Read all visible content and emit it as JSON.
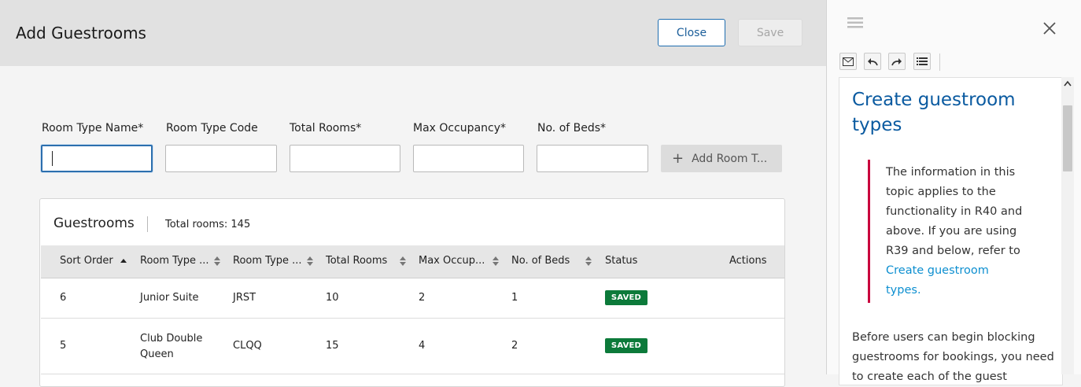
{
  "dialog": {
    "title": "Add Guestrooms",
    "close_label": "Close",
    "save_label": "Save"
  },
  "form": {
    "room_type_name_label": "Room Type Name*",
    "room_type_code_label": "Room Type Code",
    "total_rooms_label": "Total Rooms*",
    "max_occupancy_label": "Max Occupancy*",
    "no_of_beds_label": "No. of Beds*",
    "room_type_name_value": "",
    "room_type_code_value": "",
    "total_rooms_value": "",
    "max_occupancy_value": "",
    "no_of_beds_value": "",
    "add_button_label": "Add Room T..."
  },
  "grid": {
    "title": "Guestrooms",
    "total_rooms": "Total rooms: 145",
    "columns": [
      "Sort Order",
      "Room Type ...",
      "Room Type ...",
      "Total Rooms",
      "Max Occup...",
      "No. of Beds",
      "Status",
      "Actions"
    ],
    "rows": [
      {
        "sort_order": "6",
        "name": "Junior Suite",
        "code": "JRST",
        "total": "10",
        "occupancy": "2",
        "beds": "1",
        "status": "SAVED"
      },
      {
        "sort_order": "5",
        "name": "Club Double Queen",
        "code": "CLQQ",
        "total": "15",
        "occupancy": "4",
        "beds": "2",
        "status": "SAVED"
      }
    ]
  },
  "help_panel": {
    "title": "Create guestroom types",
    "note_text": "The information in this topic applies to the functionality in R40 and above. If you are using R39 and below, refer to ",
    "note_link": "Create guestroom types.",
    "body_text": "Before users can begin blocking guestrooms for bookings, you need to create each of the guest",
    "icons": [
      "menu-icon",
      "close-icon",
      "email-icon",
      "back-icon",
      "forward-icon",
      "toc-icon"
    ]
  },
  "colors": {
    "accent": "#1f6db0",
    "status_saved": "#0c7a3a",
    "note_bar": "#c9003d",
    "help_title": "#0a5aa0",
    "link": "#0d8fd0"
  }
}
